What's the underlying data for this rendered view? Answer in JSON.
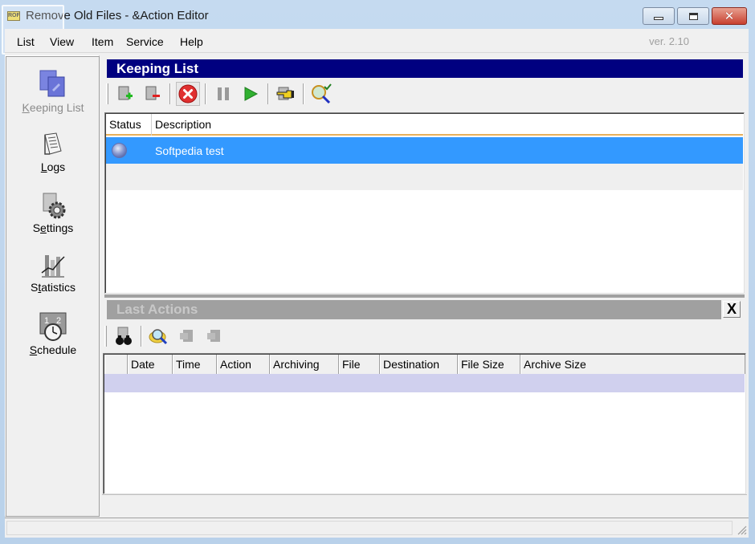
{
  "window": {
    "title": "Remove Old Files - &Action Editor",
    "app_icon_text": "ROF",
    "controls": {
      "minimize": "minimize",
      "maximize": "maximize",
      "close": "✕"
    }
  },
  "menubar": {
    "items": [
      "List",
      "View",
      "Item",
      "Service",
      "Help"
    ],
    "version": "ver. 2.10"
  },
  "sidebar": {
    "items": [
      {
        "label": "Keeping List",
        "accel": "K",
        "icon": "keeping-list-icon",
        "state": "active-disabled"
      },
      {
        "label": "Logs",
        "accel": "L",
        "icon": "logs-icon"
      },
      {
        "label": "Settings",
        "accel": "e",
        "icon": "settings-icon"
      },
      {
        "label": "Statistics",
        "accel": "t",
        "icon": "statistics-icon"
      },
      {
        "label": "Schedule",
        "accel": "S",
        "icon": "schedule-icon"
      }
    ]
  },
  "keeping_list": {
    "title": "Keeping List",
    "toolbar": [
      {
        "name": "add-item",
        "icon": "add-item-icon"
      },
      {
        "name": "remove-item",
        "icon": "remove-item-icon"
      },
      {
        "name": "stop",
        "icon": "stop-icon"
      },
      {
        "name": "pause",
        "icon": "pause-icon"
      },
      {
        "name": "run",
        "icon": "play-icon"
      },
      {
        "name": "edit-item",
        "icon": "hand-pointer-icon"
      },
      {
        "name": "check-item",
        "icon": "search-check-icon"
      }
    ],
    "columns": [
      "Status",
      "Description"
    ],
    "rows": [
      {
        "status": "idle",
        "description": "Softpedia test",
        "selected": true
      }
    ]
  },
  "last_actions": {
    "title": "Last Actions",
    "close_label": "X",
    "toolbar": [
      {
        "name": "find",
        "icon": "binoculars-icon"
      },
      {
        "name": "view",
        "icon": "magnifier-icon"
      },
      {
        "name": "export-1",
        "icon": "export-icon",
        "disabled": true
      },
      {
        "name": "export-2",
        "icon": "export-icon",
        "disabled": true
      }
    ],
    "columns": [
      "",
      "Date",
      "Time",
      "Action",
      "Archiving",
      "File",
      "Destination",
      "File Size",
      "Archive Size"
    ],
    "rows": []
  },
  "status_bar": {
    "text": ""
  },
  "colors": {
    "active_header": "#000080",
    "inactive_header": "#a0a0a0",
    "selection": "#3399ff",
    "empty_row": "#d0d0ee"
  }
}
